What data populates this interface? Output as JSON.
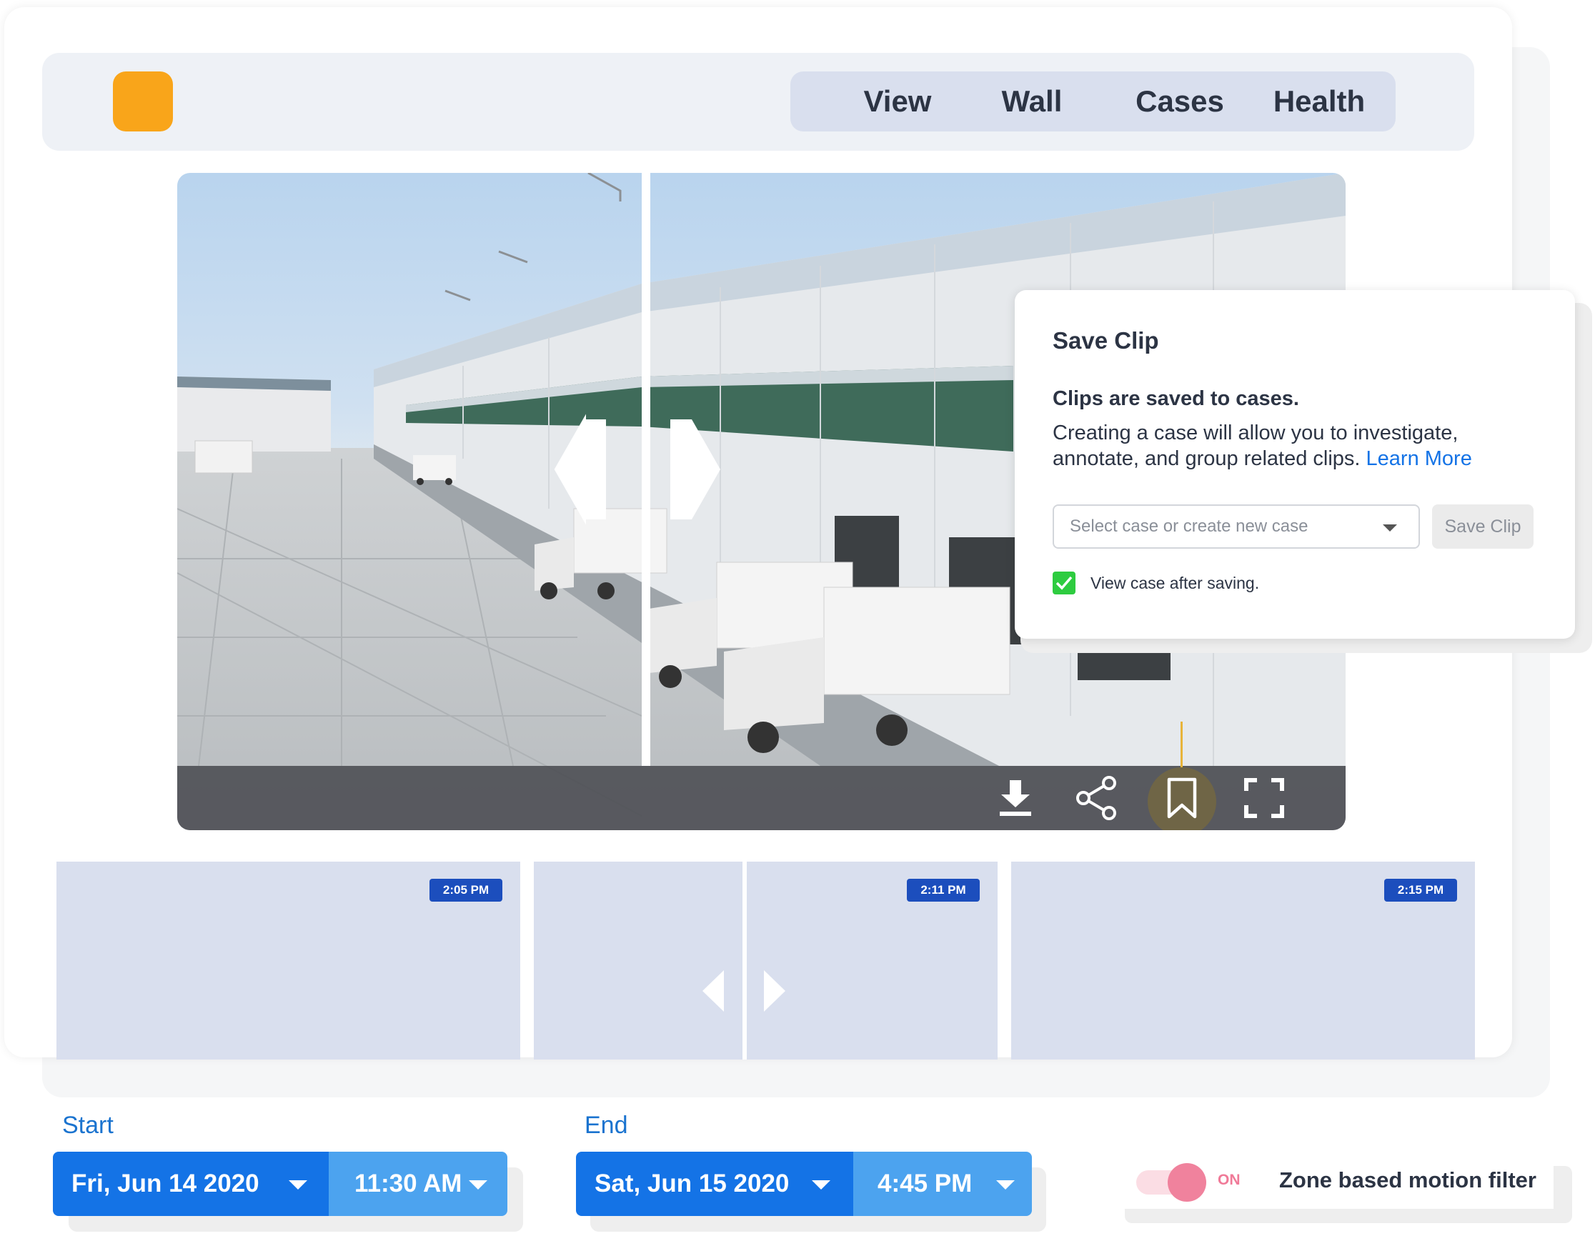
{
  "nav": {
    "items": [
      {
        "label": "View"
      },
      {
        "label": "Wall"
      },
      {
        "label": "Cases"
      },
      {
        "label": "Health"
      }
    ]
  },
  "player": {
    "controls": [
      "download-icon",
      "share-icon",
      "bookmark-icon",
      "fullscreen-icon"
    ],
    "accent_color": "#e8b43a"
  },
  "save_clip": {
    "title": "Save Clip",
    "subtitle": "Clips are saved to cases.",
    "body": "Creating a case will allow you to investigate, annotate, and group related clips.",
    "learn_more": "Learn More",
    "select_placeholder": "Select case or create new case",
    "save_button": "Save Clip",
    "checkbox_label": "View case after saving.",
    "checkbox_checked": true
  },
  "thumbnails": [
    {
      "time": "2:05 PM"
    },
    {
      "time": "2:11 PM"
    },
    {
      "time": "2:15 PM"
    }
  ],
  "range": {
    "start": {
      "label": "Start",
      "date": "Fri, Jun 14 2020",
      "time": "11:30 AM"
    },
    "end": {
      "label": "End",
      "date": "Sat, Jun 15 2020",
      "time": "4:45 PM"
    }
  },
  "motion_filter": {
    "state": "ON",
    "label": "Zone based motion filter"
  },
  "colors": {
    "logo": "#f9a51a",
    "primary_blue": "#1473e6",
    "secondary_blue": "#4ca3ef",
    "toggle_pink": "#f0829d",
    "badge_blue": "#1c4ebd"
  }
}
